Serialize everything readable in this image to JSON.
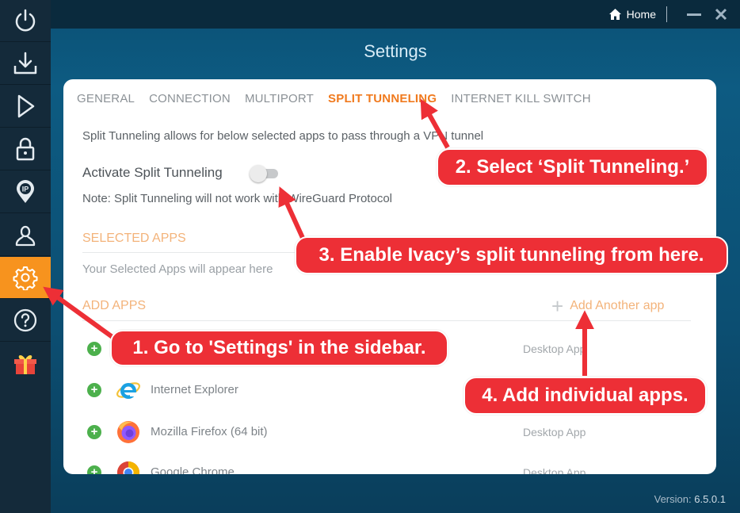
{
  "sidebar": {
    "items": [
      {
        "name": "power",
        "icon": "power-icon",
        "active": false
      },
      {
        "name": "download",
        "icon": "download-icon",
        "active": false
      },
      {
        "name": "connect",
        "icon": "play-icon",
        "active": false
      },
      {
        "name": "security",
        "icon": "lock-icon",
        "active": false
      },
      {
        "name": "ip",
        "icon": "ip-location-icon",
        "active": false
      },
      {
        "name": "account",
        "icon": "user-icon",
        "active": false
      },
      {
        "name": "settings",
        "icon": "gear-icon",
        "active": true
      },
      {
        "name": "help",
        "icon": "help-icon",
        "active": false
      },
      {
        "name": "gift",
        "icon": "gift-icon",
        "active": false
      }
    ],
    "active_color": "#f7931e"
  },
  "topbar": {
    "home_label": "Home"
  },
  "page_title": "Settings",
  "tabs": [
    {
      "label": "GENERAL",
      "active": false
    },
    {
      "label": "CONNECTION",
      "active": false
    },
    {
      "label": "MULTIPORT",
      "active": false
    },
    {
      "label": "SPLIT TUNNELING",
      "active": true
    },
    {
      "label": "INTERNET KILL SWITCH",
      "active": false
    }
  ],
  "split_tunneling": {
    "description": "Split Tunneling allows for below selected apps to pass through a VPN tunnel",
    "activate_label": "Activate Split Tunneling",
    "activated": false,
    "note": "Note: Split Tunneling will not work with WireGuard Protocol",
    "selected_apps_heading": "SELECTED APPS",
    "selected_apps_placeholder": "Your Selected Apps will appear here",
    "add_apps_heading": "ADD APPS",
    "add_another_label": "Add Another app",
    "apps": [
      {
        "name": "",
        "type": "Desktop App",
        "icon": "app-icon"
      },
      {
        "name": "Internet Explorer",
        "type": "",
        "icon": "internet-explorer-icon"
      },
      {
        "name": "Mozilla Firefox (64 bit)",
        "type": "Desktop App",
        "icon": "firefox-icon"
      },
      {
        "name": "Google Chrome",
        "type": "Desktop App",
        "icon": "chrome-icon"
      }
    ]
  },
  "version": {
    "label": "Version:",
    "value": "6.5.0.1"
  },
  "annotations": [
    {
      "text": "1. Go to 'Settings' in the sidebar."
    },
    {
      "text": "2. Select ‘Split Tunneling.’"
    },
    {
      "text": "3. Enable Ivacy’s split tunneling from here."
    },
    {
      "text": "4. Add individual apps."
    }
  ],
  "colors": {
    "accent": "#f07a1e",
    "annotation": "#ed2f36",
    "add_green": "#4cb04c"
  }
}
